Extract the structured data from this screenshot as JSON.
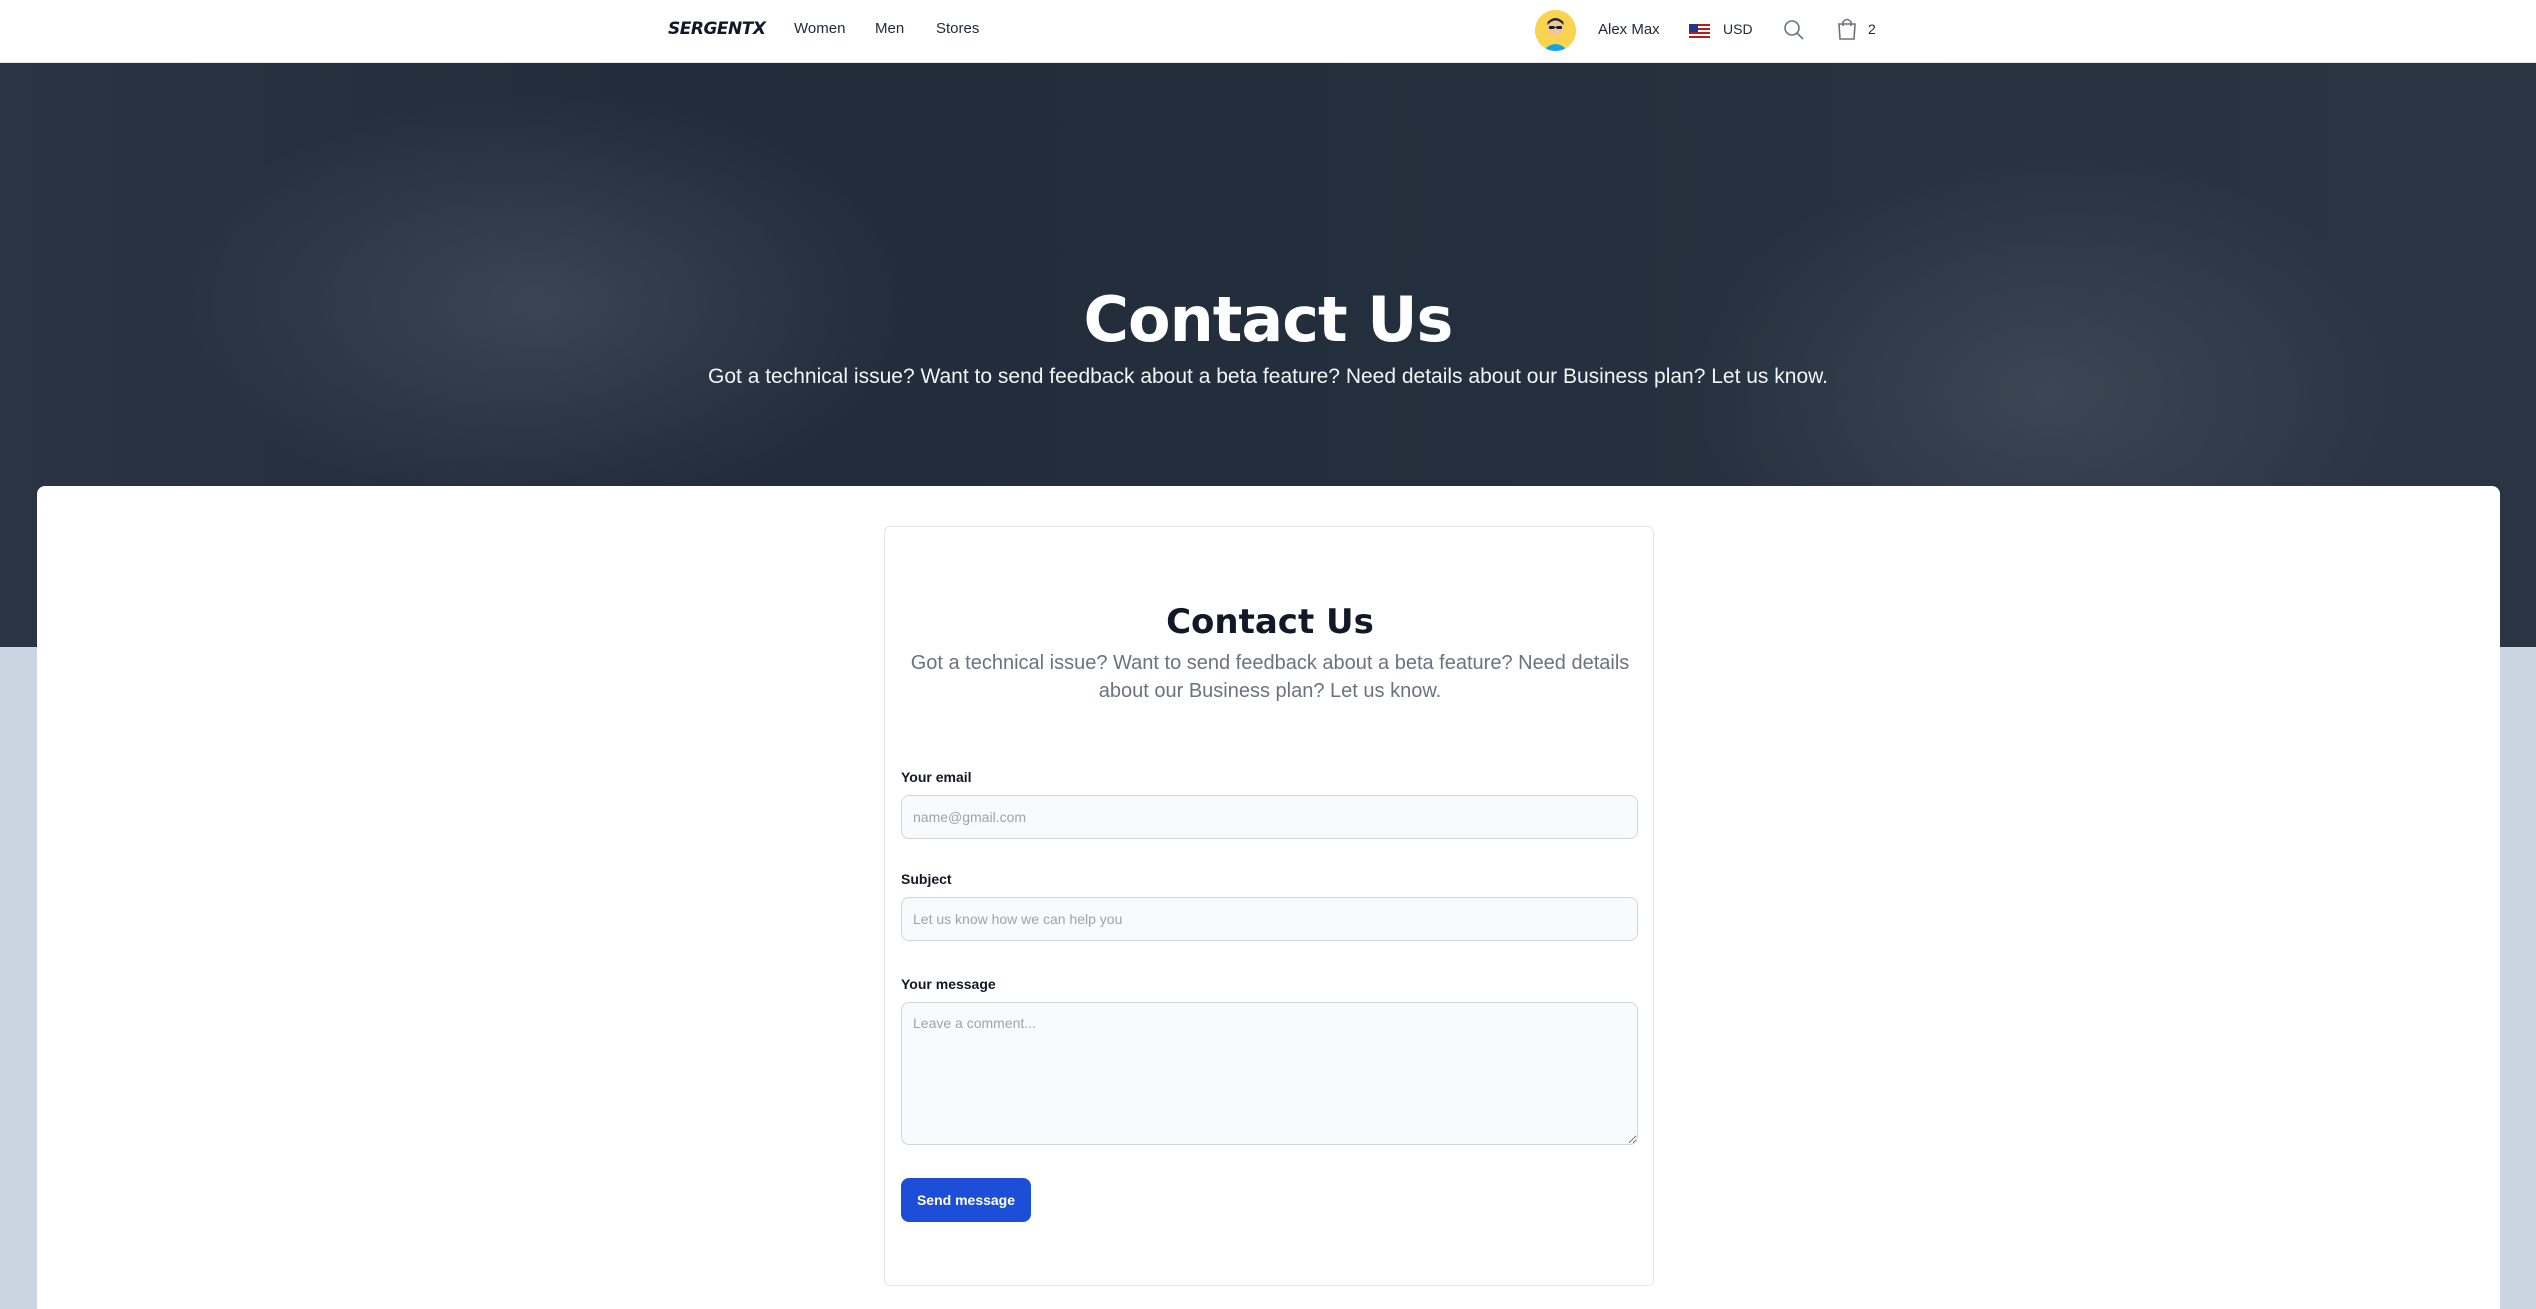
{
  "nav": {
    "logo": "SERGENTX",
    "links": [
      "Women",
      "Men",
      "Stores"
    ],
    "user_name": "Alex Max",
    "currency": "USD",
    "cart_count": "2"
  },
  "hero": {
    "title": "Contact Us",
    "subtitle": "Got a technical issue? Want to send feedback about a beta feature? Need details about our Business plan? Let us know."
  },
  "form": {
    "title": "Contact Us",
    "subtitle": "Got a technical issue? Want to send feedback about a beta feature? Need details about our Business plan? Let us know.",
    "email_label": "Your email",
    "email_placeholder": "name@gmail.com",
    "subject_label": "Subject",
    "subject_placeholder": "Let us know how we can help you",
    "message_label": "Your message",
    "message_placeholder": "Leave a comment...",
    "submit_label": "Send message"
  },
  "colors": {
    "primary": "#1d4ed8",
    "page_background": "#cbd5e1"
  },
  "icons": [
    "user-avatar",
    "us-flag-icon",
    "search-icon",
    "shopping-bag-icon"
  ]
}
